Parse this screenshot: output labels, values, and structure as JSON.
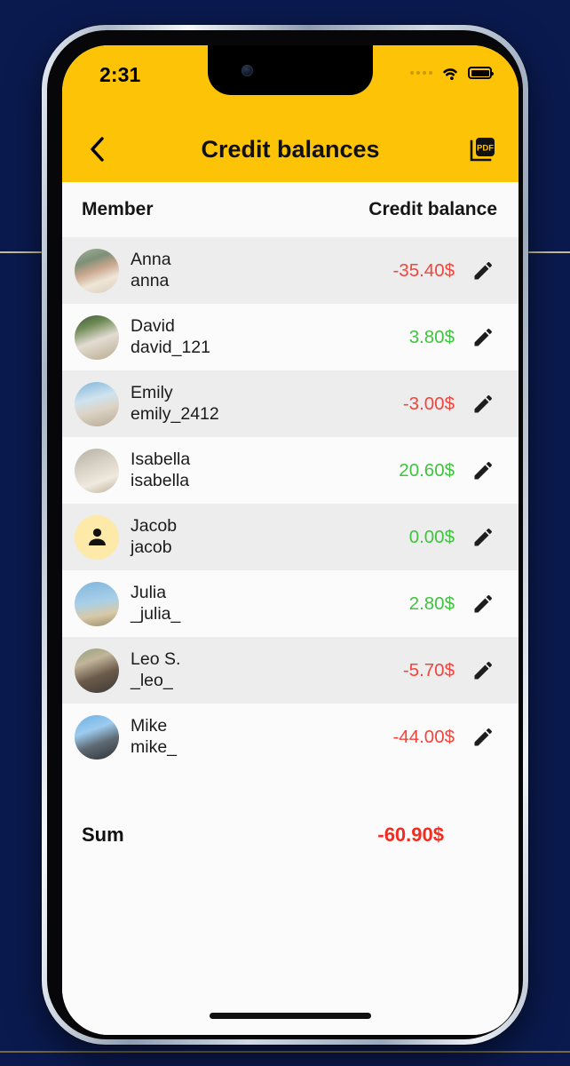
{
  "status_bar": {
    "time": "2:31",
    "cellular_icon": "cellular-dots-icon",
    "wifi_icon": "wifi-icon",
    "battery_icon": "battery-full-icon"
  },
  "app_bar": {
    "back_icon": "chevron-left-icon",
    "title": "Credit balances",
    "pdf_label": "PDF",
    "pdf_icon": "pdf-export-icon"
  },
  "table": {
    "columns": {
      "member": "Member",
      "balance": "Credit balance"
    },
    "rows": [
      {
        "name": "Anna",
        "handle": "anna",
        "balance": "-35.40$",
        "sign": "neg",
        "avatar": "photo",
        "edit_icon": "pencil-icon"
      },
      {
        "name": "David",
        "handle": "david_121",
        "balance": "3.80$",
        "sign": "pos",
        "avatar": "photo",
        "edit_icon": "pencil-icon"
      },
      {
        "name": "Emily",
        "handle": "emily_2412",
        "balance": "-3.00$",
        "sign": "neg",
        "avatar": "photo",
        "edit_icon": "pencil-icon"
      },
      {
        "name": "Isabella",
        "handle": "isabella",
        "balance": "20.60$",
        "sign": "pos",
        "avatar": "photo",
        "edit_icon": "pencil-icon"
      },
      {
        "name": "Jacob",
        "handle": "jacob",
        "balance": "0.00$",
        "sign": "pos",
        "avatar": "placeholder",
        "edit_icon": "pencil-icon"
      },
      {
        "name": "Julia",
        "handle": "_julia_",
        "balance": "2.80$",
        "sign": "pos",
        "avatar": "photo",
        "edit_icon": "pencil-icon"
      },
      {
        "name": "Leo S.",
        "handle": "_leo_",
        "balance": "-5.70$",
        "sign": "neg",
        "avatar": "photo",
        "edit_icon": "pencil-icon"
      },
      {
        "name": "Mike",
        "handle": "mike_",
        "balance": "-44.00$",
        "sign": "neg",
        "avatar": "photo",
        "edit_icon": "pencil-icon"
      }
    ]
  },
  "summary": {
    "label": "Sum",
    "value": "-60.90$",
    "sign": "neg"
  },
  "colors": {
    "accent_yellow": "#fdc307",
    "negative_red": "#f1453d",
    "positive_green": "#3ec43e",
    "sum_red": "#f42b20",
    "row_alt": "#ededed",
    "row_base": "#fbfbfb",
    "backdrop": "#0a1a4f"
  }
}
